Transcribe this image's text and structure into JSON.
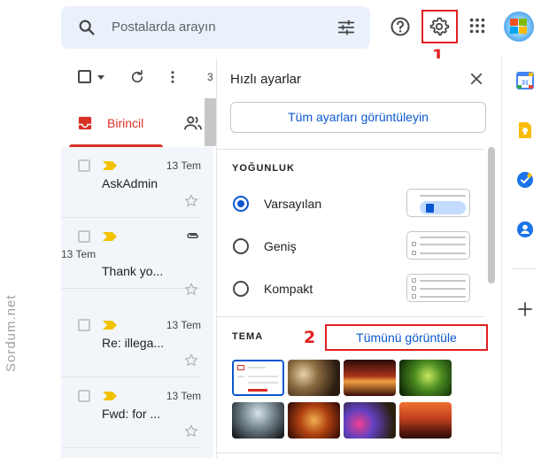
{
  "header": {
    "search_placeholder": "Postalarda arayın",
    "icons": [
      "search-icon",
      "tune-icon",
      "help-icon",
      "gear-icon",
      "apps-icon",
      "avatar"
    ]
  },
  "annotations": {
    "marker_1": "1",
    "marker_2": "2"
  },
  "toolbar": {
    "count_partial": "3"
  },
  "tabs": {
    "primary_label": "Birincil"
  },
  "mail_list": {
    "rows": [
      {
        "date": "13 Tem",
        "sender": "AskAdmin"
      },
      {
        "date": "13 Tem",
        "sender": "Thank yo..."
      },
      {
        "date": "13 Tem",
        "sender": "Re: illega..."
      },
      {
        "date": "13 Tem",
        "sender": "Fwd: for ..."
      }
    ]
  },
  "watermark": "Sordum.net",
  "quick_settings": {
    "title": "Hızlı ayarlar",
    "all_settings_button": "Tüm ayarları görüntüleyin",
    "density": {
      "heading": "YOĞUNLUK",
      "options": [
        {
          "label": "Varsayılan",
          "selected": true
        },
        {
          "label": "Geniş",
          "selected": false
        },
        {
          "label": "Kompakt",
          "selected": false
        }
      ]
    },
    "theme": {
      "heading": "TEMA",
      "show_all": "Tümünü görüntüle"
    }
  },
  "colors": {
    "accent_blue": "#0b57d0",
    "primary_red": "#d93025",
    "annotation_red": "#e02020"
  }
}
